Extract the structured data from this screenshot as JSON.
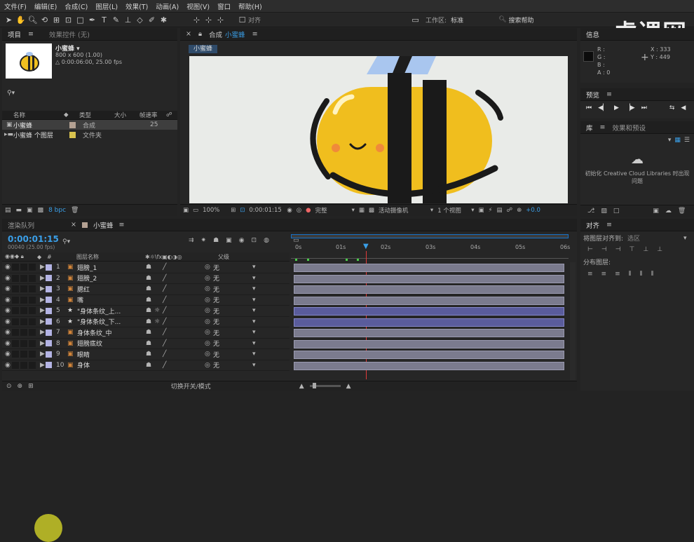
{
  "menu": [
    "文件(F)",
    "编辑(E)",
    "合成(C)",
    "图层(L)",
    "效果(T)",
    "动画(A)",
    "视图(V)",
    "窗口",
    "帮助(H)"
  ],
  "toolbar": {
    "align_label": "对齐",
    "workspace_label": "工作区:",
    "workspace_value": "标准",
    "search_placeholder": "搜索帮助"
  },
  "watermark": "虎课网",
  "project": {
    "tab1": "项目",
    "tab2": "效果控件 (无)",
    "comp_name": "小蜜蜂 ▾",
    "dims": "800 x 600 (1.00)",
    "duration": "△ 0:00:06:00, 25.00 fps",
    "cols": [
      "名称",
      "类型",
      "大小",
      "帧速率"
    ],
    "items": [
      {
        "name": "小蜜蜂",
        "type": "合成",
        "size": "",
        "fps": "25",
        "color": "#b4a193"
      },
      {
        "name": "小蜜蜂 个图层",
        "type": "文件夹",
        "size": "",
        "fps": "",
        "color": "#d8c24e"
      }
    ],
    "bpc": "8 bpc"
  },
  "viewer": {
    "tab_prefix": "合成",
    "tab_name": "小蜜蜂",
    "sub_tab": "小蜜蜂",
    "zoom": "100%",
    "time": "0:00:01:15",
    "quality": "完整",
    "camera": "活动摄像机",
    "views": "1 个视图",
    "offset": "+0.0"
  },
  "info": {
    "r": "R :",
    "g": "G :",
    "b": "B :",
    "a": "A : 0",
    "x": "X : 333",
    "y": "Y : 449"
  },
  "preview": {
    "title": "预览"
  },
  "library": {
    "tab1": "库",
    "tab2": "效果和预设",
    "msg": "初始化 Creative Cloud Libraries 时出现问题"
  },
  "align": {
    "title": "对齐",
    "align_to_label": "将图层对齐到:",
    "align_to_value": "选区",
    "distribute_label": "分布图层:"
  },
  "timeline": {
    "tab1": "渲染队列",
    "tab2": "小蜜蜂",
    "timecode": "0:00:01:15",
    "frames": "00040 (25.00 fps)",
    "col_name": "图层名称",
    "col_parent": "父级",
    "footer": "切换开关/模式",
    "ruler": [
      "0s",
      "01s",
      "02s",
      "03s",
      "04s",
      "05s",
      "06s"
    ],
    "layers": [
      {
        "num": "1",
        "name": "翅膀_1",
        "parent": "无",
        "color": "#b4b4e4",
        "type": "shape"
      },
      {
        "num": "2",
        "name": "翅膀_2",
        "parent": "无",
        "color": "#b4b4e4",
        "type": "shape"
      },
      {
        "num": "3",
        "name": "腮红",
        "parent": "无",
        "color": "#b4b4e4",
        "type": "shape"
      },
      {
        "num": "4",
        "name": "嘴",
        "parent": "无",
        "color": "#b4b4e4",
        "type": "shape"
      },
      {
        "num": "5",
        "name": "\"身体条纹_上...",
        "parent": "无",
        "color": "#b4b4e4",
        "type": "star"
      },
      {
        "num": "6",
        "name": "\"身体条纹_下...",
        "parent": "无",
        "color": "#b4b4e4",
        "type": "star"
      },
      {
        "num": "7",
        "name": "身体条纹_中",
        "parent": "无",
        "color": "#b4b4e4",
        "type": "shape"
      },
      {
        "num": "8",
        "name": "翅膀底纹",
        "parent": "无",
        "color": "#b4b4e4",
        "type": "shape"
      },
      {
        "num": "9",
        "name": "眼睛",
        "parent": "无",
        "color": "#b4b4e4",
        "type": "shape"
      },
      {
        "num": "10",
        "name": "身体",
        "parent": "无",
        "color": "#b4b4e4",
        "type": "shape"
      }
    ]
  }
}
